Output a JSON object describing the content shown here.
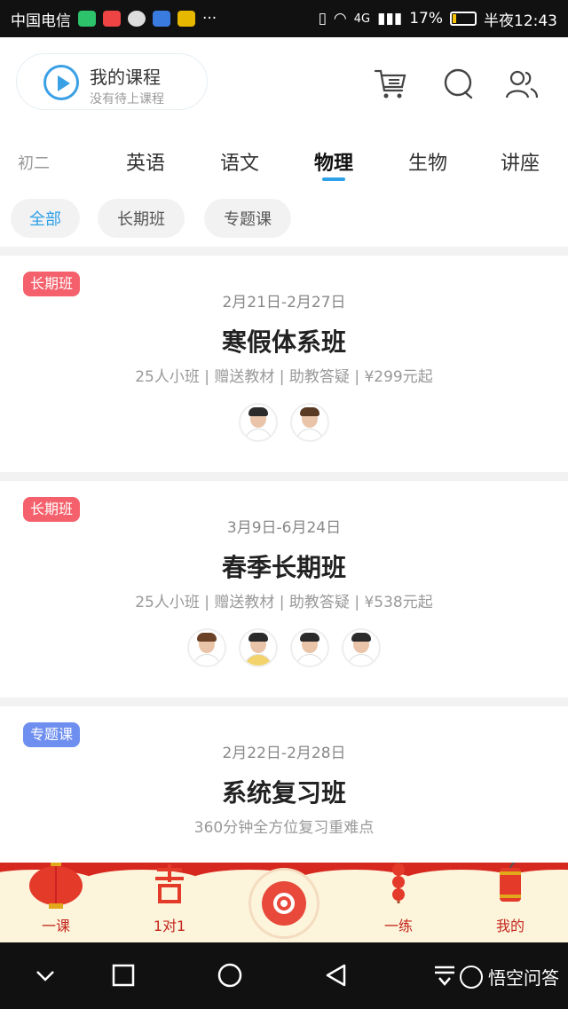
{
  "status_bar": {
    "carrier": "中国电信",
    "network": "4G",
    "battery": "17%",
    "battery_level": 0.17,
    "time": "半夜12:43"
  },
  "header": {
    "course_title": "我的课程",
    "course_subtitle": "没有待上课程",
    "icons": [
      "cart-icon",
      "message-icon",
      "user-icon"
    ]
  },
  "tabs": {
    "grade": "初二",
    "items": [
      "英语",
      "语文",
      "物理",
      "生物",
      "讲座"
    ],
    "active_index": 2
  },
  "filters": {
    "chips": [
      "全部",
      "长期班",
      "专题课"
    ],
    "active_index": 0
  },
  "cards": [
    {
      "tag": "长期班",
      "date": "2月21日-2月27日",
      "title": "寒假体系班",
      "features": "25人小班 | 赠送教材 | 助教答疑 | ¥299元起"
    },
    {
      "tag": "长期班",
      "date": "3月9日-6月24日",
      "title": "春季长期班",
      "features": "25人小班 | 赠送教材 | 助教答疑 | ¥538元起"
    },
    {
      "tag": "专题课",
      "date": "2月22日-2月28日",
      "title": "系统复习班",
      "features": "360分钟全方位复习重难点"
    }
  ],
  "bottom_nav": {
    "items": [
      "一课",
      "1对1",
      "一练",
      "我的"
    ]
  },
  "watermark": "悟空问答",
  "colors": {
    "accent": "#2ea0e8",
    "tag_red": "#f4606b",
    "tag_blue": "#6f8ff0",
    "festive_red": "#d7281f"
  }
}
